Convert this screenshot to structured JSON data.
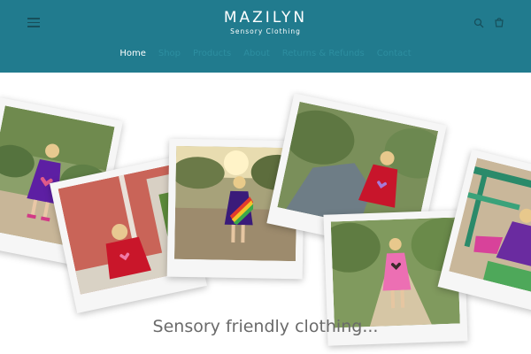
{
  "header": {
    "brand_name": "MAZILYN",
    "brand_tagline": "Sensory Clothing",
    "background": "#217b8e"
  },
  "nav": {
    "items": [
      {
        "label": "Home",
        "active": true
      },
      {
        "label": "Shop",
        "active": false
      },
      {
        "label": "Products",
        "active": false
      },
      {
        "label": "About",
        "active": false
      },
      {
        "label": "Returns & Refunds",
        "active": false
      },
      {
        "label": "Contact",
        "active": false
      }
    ]
  },
  "icons": {
    "menu": "hamburger-menu-icon",
    "search": "search-icon",
    "cart": "cart-icon"
  },
  "hero": {
    "tagline": "Sensory friendly clothing...",
    "photos": [
      {
        "name": "girl-purple-dress-heart"
      },
      {
        "name": "girl-red-dress-door"
      },
      {
        "name": "girl-rainbow-dress-sunset"
      },
      {
        "name": "girl-red-dress-rock"
      },
      {
        "name": "girl-pink-dress-path"
      },
      {
        "name": "girl-purple-dress-playground"
      }
    ]
  }
}
